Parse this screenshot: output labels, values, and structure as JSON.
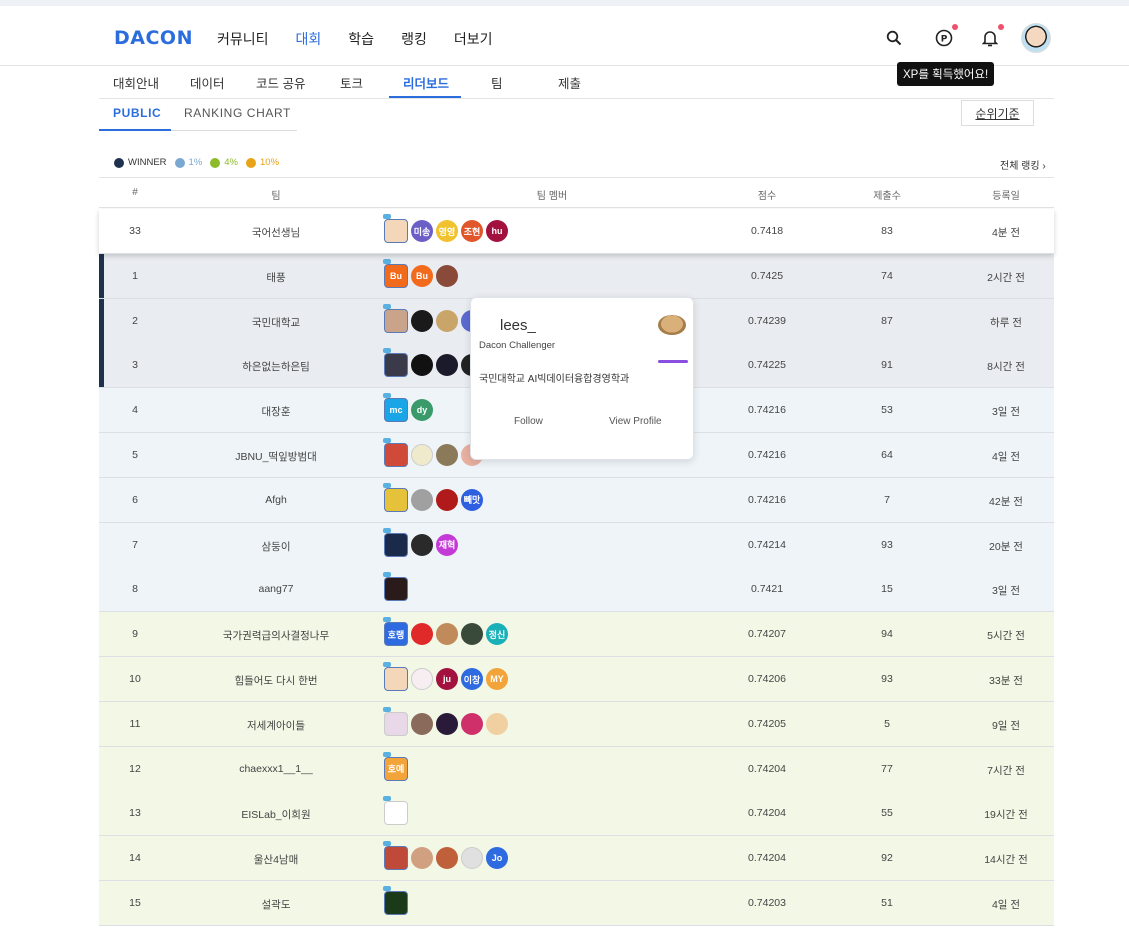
{
  "header": {
    "logo": "DACON",
    "nav": [
      "커뮤니티",
      "대회",
      "학습",
      "랭킹",
      "더보기"
    ],
    "active_nav": "대회",
    "icons": [
      "search-icon",
      "point-icon",
      "bell-icon"
    ],
    "tooltip": "XP를 획득했어요!"
  },
  "subtabs": [
    "대회안내",
    "데이터",
    "코드 공유",
    "토크",
    "리더보드",
    "팀",
    "제출"
  ],
  "active_subtab": "리더보드",
  "board_tabs": [
    "PUBLIC",
    "RANKING CHART"
  ],
  "rank_criteria_button": "순위기준",
  "legend": [
    {
      "label": "WINNER",
      "color": "#1e3250"
    },
    {
      "label": "1%",
      "color": "#7aa8d0"
    },
    {
      "label": "4%",
      "color": "#8dbb2a"
    },
    {
      "label": "10%",
      "color": "#e8a317"
    }
  ],
  "full_ranking_link": "전체 랭킹 ›",
  "table": {
    "headers": [
      "#",
      "팀",
      "팀 멤버",
      "점수",
      "제출수",
      "등록일"
    ],
    "rows": [
      {
        "rank": "33",
        "team": "국어선생님",
        "score": "0.7418",
        "submissions": "83",
        "date": "4분 전",
        "tier": "mine",
        "members": [
          {
            "t": "",
            "c": "#f3d7b8"
          },
          {
            "t": "미송",
            "c": "#6b5fc7"
          },
          {
            "t": "영영",
            "c": "#f2c12e"
          },
          {
            "t": "조현",
            "c": "#e0572b"
          },
          {
            "t": "hu",
            "c": "#a3123f"
          }
        ]
      },
      {
        "rank": "1",
        "team": "태풍",
        "score": "0.7425",
        "submissions": "74",
        "date": "2시간 전",
        "tier": "winner",
        "members": [
          {
            "t": "Bu",
            "c": "#f26a1b"
          },
          {
            "t": "Bu",
            "c": "#f26a1b"
          },
          {
            "t": "",
            "c": "#8a4a3a"
          }
        ]
      },
      {
        "rank": "2",
        "team": "국민대학교",
        "score": "0.74239",
        "submissions": "87",
        "date": "하루 전",
        "tier": "winner",
        "members": [
          {
            "t": "",
            "c": "#c9a38a"
          },
          {
            "t": "",
            "c": "#1a1a1a"
          },
          {
            "t": "",
            "c": "#c9a56a"
          },
          {
            "t": "",
            "c": "#5a6ad0"
          }
        ]
      },
      {
        "rank": "3",
        "team": "하은없는하은팀",
        "score": "0.74225",
        "submissions": "91",
        "date": "8시간 전",
        "tier": "winner",
        "members": [
          {
            "t": "",
            "c": "#3a3a4a"
          },
          {
            "t": "",
            "c": "#111"
          },
          {
            "t": "",
            "c": "#1a1a2a"
          },
          {
            "t": "",
            "c": "#222"
          }
        ]
      },
      {
        "rank": "4",
        "team": "대장훈",
        "score": "0.74216",
        "submissions": "53",
        "date": "3일 전",
        "tier": "p1",
        "members": [
          {
            "t": "mc",
            "c": "#1aa6e6"
          },
          {
            "t": "dy",
            "c": "#3a9a6a"
          }
        ]
      },
      {
        "rank": "5",
        "team": "JBNU_떡잎방범대",
        "score": "0.74216",
        "submissions": "64",
        "date": "4일 전",
        "tier": "p1",
        "members": [
          {
            "t": "",
            "c": "#d04a3a"
          },
          {
            "t": "",
            "c": "#f0eacc"
          },
          {
            "t": "",
            "c": "#8a7a5a"
          },
          {
            "t": "",
            "c": "#e8b0a0"
          }
        ]
      },
      {
        "rank": "6",
        "team": "Afgh",
        "score": "0.74216",
        "submissions": "7",
        "date": "42분 전",
        "tier": "p1",
        "members": [
          {
            "t": "",
            "c": "#e6c23a"
          },
          {
            "t": "",
            "c": "#a0a0a0"
          },
          {
            "t": "",
            "c": "#b01a1a"
          },
          {
            "t": "빼맛",
            "c": "#2e5fe0"
          }
        ]
      },
      {
        "rank": "7",
        "team": "삼둥이",
        "score": "0.74214",
        "submissions": "93",
        "date": "20분 전",
        "tier": "p1",
        "members": [
          {
            "t": "",
            "c": "#1a2a4a"
          },
          {
            "t": "",
            "c": "#2a2a2a"
          },
          {
            "t": "재혁",
            "c": "#c43ad6"
          }
        ]
      },
      {
        "rank": "8",
        "team": "aang77",
        "score": "0.7421",
        "submissions": "15",
        "date": "3일 전",
        "tier": "p1",
        "members": [
          {
            "t": "",
            "c": "#2a1a1a"
          }
        ]
      },
      {
        "rank": "9",
        "team": "국가권력급의사결정나무",
        "score": "0.74207",
        "submissions": "94",
        "date": "5시간 전",
        "tier": "p4",
        "members": [
          {
            "t": "호랭",
            "c": "#2e6ae0"
          },
          {
            "t": "",
            "c": "#e02a2a"
          },
          {
            "t": "",
            "c": "#c08a5a"
          },
          {
            "t": "",
            "c": "#3a4a3a"
          },
          {
            "t": "정신",
            "c": "#1ab0b8"
          }
        ]
      },
      {
        "rank": "10",
        "team": "힘들어도 다시 한번",
        "score": "0.74206",
        "submissions": "93",
        "date": "33분 전",
        "tier": "p4",
        "members": [
          {
            "t": "",
            "c": "#f3d7b8"
          },
          {
            "t": "",
            "c": "#f6eef0"
          },
          {
            "t": "ju",
            "c": "#a3123f"
          },
          {
            "t": "이창",
            "c": "#2e6ae0"
          },
          {
            "t": "MY",
            "c": "#f2a33a"
          }
        ]
      },
      {
        "rank": "11",
        "team": "저세계아이들",
        "score": "0.74205",
        "submissions": "5",
        "date": "9일 전",
        "tier": "p4",
        "members": [
          {
            "t": "",
            "c": "#e8d8e8"
          },
          {
            "t": "",
            "c": "#8a6a5a"
          },
          {
            "t": "",
            "c": "#2a1a3a"
          },
          {
            "t": "",
            "c": "#d0306a"
          },
          {
            "t": "",
            "c": "#f0d0a0"
          }
        ]
      },
      {
        "rank": "12",
        "team": "chaexxx1__1__",
        "score": "0.74204",
        "submissions": "77",
        "date": "7시간 전",
        "tier": "p4",
        "members": [
          {
            "t": "호예",
            "c": "#f2a33a"
          }
        ]
      },
      {
        "rank": "13",
        "team": "EISLab_이희원",
        "score": "0.74204",
        "submissions": "55",
        "date": "19시간 전",
        "tier": "p4",
        "members": [
          {
            "t": "",
            "c": "#ffffff"
          }
        ]
      },
      {
        "rank": "14",
        "team": "울산4남매",
        "score": "0.74204",
        "submissions": "92",
        "date": "14시간 전",
        "tier": "p4",
        "members": [
          {
            "t": "",
            "c": "#c04a3a"
          },
          {
            "t": "",
            "c": "#d0a080"
          },
          {
            "t": "",
            "c": "#c0603a"
          },
          {
            "t": "",
            "c": "#e0e0e0"
          },
          {
            "t": "Jo",
            "c": "#2e6ae0"
          }
        ]
      },
      {
        "rank": "15",
        "team": "설곽도",
        "score": "0.74203",
        "submissions": "51",
        "date": "4일 전",
        "tier": "p4",
        "members": [
          {
            "t": "",
            "c": "#1a3a1a"
          }
        ]
      }
    ]
  },
  "profile_popup": {
    "name": "lees_",
    "role": "Dacon Challenger",
    "org": "국민대학교 AI빅데이터융합경영학과",
    "follow": "Follow",
    "view_profile": "View Profile"
  }
}
